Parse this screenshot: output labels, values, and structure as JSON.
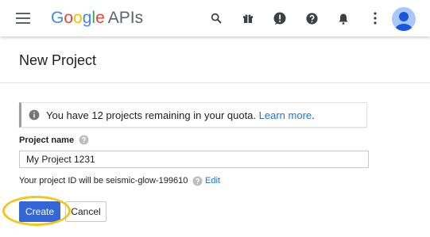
{
  "header": {
    "logo_google": [
      "G",
      "o",
      "o",
      "g",
      "l",
      "e"
    ],
    "logo_colors": [
      "#4285f4",
      "#ea4335",
      "#fbbc05",
      "#4285f4",
      "#34a853",
      "#ea4335"
    ],
    "logo_suffix": "APIs",
    "icons": [
      "search-icon",
      "gift-icon",
      "alert-icon",
      "help-icon",
      "notifications-icon",
      "more-vert-icon"
    ]
  },
  "page": {
    "title": "New Project"
  },
  "quota": {
    "message": "You have 12 projects remaining in your quota.",
    "link_label": "Learn more",
    "trailing": "."
  },
  "form": {
    "project_name_label": "Project name",
    "project_name_value": "My Project 1231",
    "project_id_text": "Your project ID will be seismic-glow-199610",
    "edit_label": "Edit"
  },
  "actions": {
    "create_label": "Create",
    "cancel_label": "Cancel"
  },
  "colors": {
    "accent": "#3367d6",
    "link": "#1a73e8",
    "highlight": "#f5c518"
  }
}
